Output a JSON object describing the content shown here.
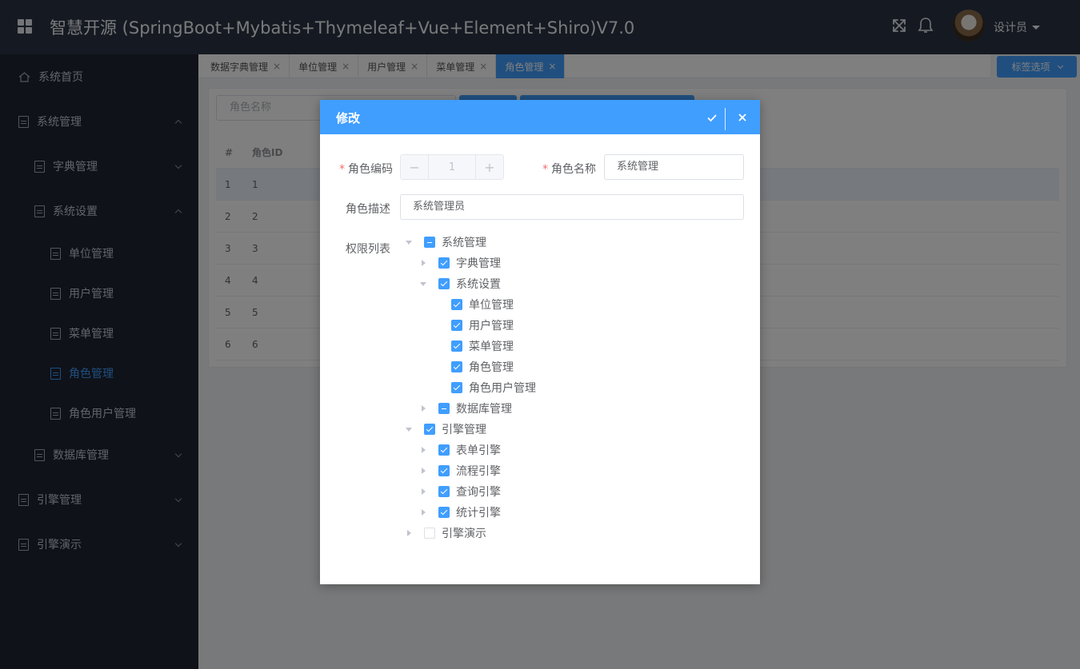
{
  "header": {
    "title": "智慧开源 (SpringBoot+Mybatis+Thymeleaf+Vue+Element+Shiro)V7.0",
    "user_name": "设计员",
    "icons": [
      "grid-icon",
      "fullscreen-icon",
      "bell-icon",
      "avatar"
    ]
  },
  "sidebar": {
    "items": [
      {
        "label": "系统首页"
      },
      {
        "label": "系统管理"
      },
      {
        "label": "字典管理"
      },
      {
        "label": "系统设置"
      },
      {
        "label": "单位管理"
      },
      {
        "label": "用户管理"
      },
      {
        "label": "菜单管理"
      },
      {
        "label": "角色管理"
      },
      {
        "label": "角色用户管理"
      },
      {
        "label": "数据库管理"
      },
      {
        "label": "引擎管理"
      },
      {
        "label": "引擎演示"
      }
    ]
  },
  "tabs": {
    "items": [
      {
        "label": "数据字典管理"
      },
      {
        "label": "单位管理"
      },
      {
        "label": "用户管理"
      },
      {
        "label": "菜单管理"
      },
      {
        "label": "角色管理"
      }
    ],
    "close_glyph": "×",
    "tag_options_label": "标签选项"
  },
  "list": {
    "search_placeholder": "角色名称",
    "headers": [
      "#",
      "角色ID"
    ],
    "rows": [
      [
        "1",
        "1"
      ],
      [
        "2",
        "2"
      ],
      [
        "3",
        "3"
      ],
      [
        "4",
        "4"
      ],
      [
        "5",
        "5"
      ],
      [
        "6",
        "6"
      ]
    ]
  },
  "dialog": {
    "title": "修改",
    "code_label": "角色编码",
    "code_value": "1",
    "stepper_minus": "−",
    "stepper_plus": "+",
    "name_label": "角色名称",
    "name_value": "系统管理",
    "desc_label": "角色描述",
    "desc_value": "系统管理员",
    "perm_label": "权限列表",
    "required_mark": "*"
  },
  "tree": [
    {
      "label": "系统管理",
      "level": 0,
      "state": "partial",
      "expand": "down"
    },
    {
      "label": "字典管理",
      "level": 1,
      "state": "checked",
      "expand": "right"
    },
    {
      "label": "系统设置",
      "level": 1,
      "state": "checked",
      "expand": "down"
    },
    {
      "label": "单位管理",
      "level": 2,
      "state": "checked",
      "expand": "none"
    },
    {
      "label": "用户管理",
      "level": 2,
      "state": "checked",
      "expand": "none"
    },
    {
      "label": "菜单管理",
      "level": 2,
      "state": "checked",
      "expand": "none"
    },
    {
      "label": "角色管理",
      "level": 2,
      "state": "checked",
      "expand": "none"
    },
    {
      "label": "角色用户管理",
      "level": 2,
      "state": "checked",
      "expand": "none"
    },
    {
      "label": "数据库管理",
      "level": 1,
      "state": "partial",
      "expand": "right"
    },
    {
      "label": "引擎管理",
      "level": 0,
      "state": "checked",
      "expand": "down"
    },
    {
      "label": "表单引擎",
      "level": 1,
      "state": "checked",
      "expand": "right"
    },
    {
      "label": "流程引擎",
      "level": 1,
      "state": "checked",
      "expand": "right"
    },
    {
      "label": "查询引擎",
      "level": 1,
      "state": "checked",
      "expand": "right"
    },
    {
      "label": "统计引擎",
      "level": 1,
      "state": "checked",
      "expand": "right"
    },
    {
      "label": "引擎演示",
      "level": 0,
      "state": "unchecked",
      "expand": "right"
    }
  ],
  "colors": {
    "primary": "#409eff",
    "header_bg": "#2b3445",
    "sidebar_bg": "#1e2533",
    "required": "#f56c6c"
  }
}
